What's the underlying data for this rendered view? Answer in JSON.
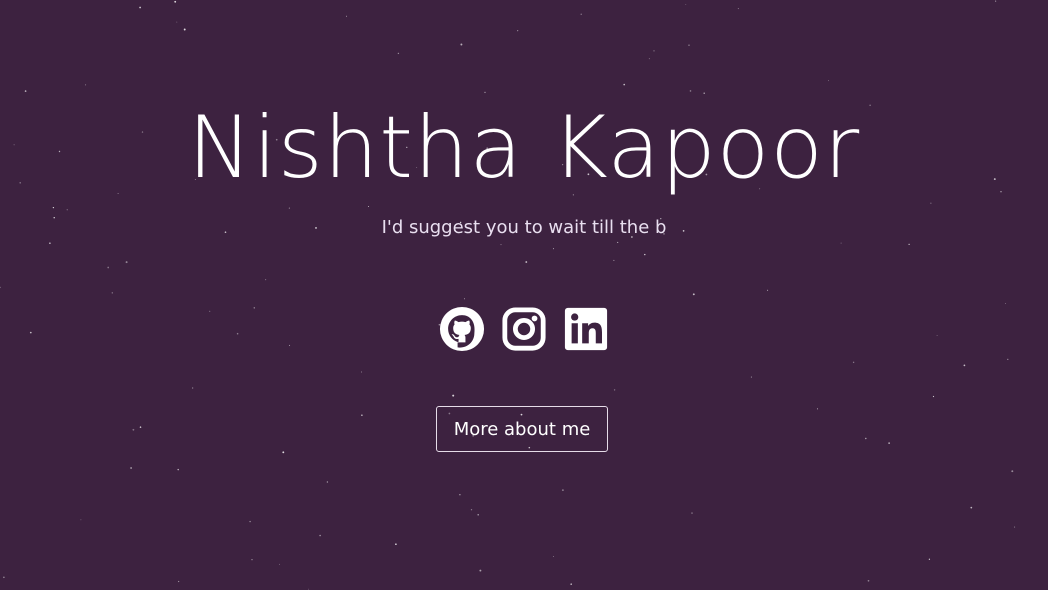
{
  "hero": {
    "name": "Nishtha Kapoor",
    "tagline": "I'd suggest you to wait till the b",
    "more_label": "More about me"
  },
  "social": [
    {
      "icon": "github-icon"
    },
    {
      "icon": "instagram-icon"
    },
    {
      "icon": "linkedin-icon"
    }
  ],
  "colors": {
    "background": "#3d2240",
    "text": "#ffffff"
  }
}
